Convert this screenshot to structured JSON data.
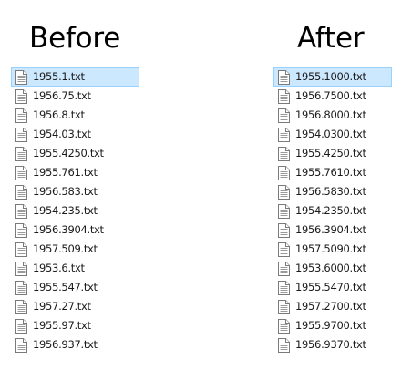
{
  "before": {
    "title": "Before",
    "selected_index": 0,
    "files": [
      "1955.1.txt",
      "1956.75.txt",
      "1956.8.txt",
      "1954.03.txt",
      "1955.4250.txt",
      "1955.761.txt",
      "1956.583.txt",
      "1954.235.txt",
      "1956.3904.txt",
      "1957.509.txt",
      "1953.6.txt",
      "1955.547.txt",
      "1957.27.txt",
      "1955.97.txt",
      "1956.937.txt"
    ]
  },
  "after": {
    "title": "After",
    "selected_index": 0,
    "files": [
      "1955.1000.txt",
      "1956.7500.txt",
      "1956.8000.txt",
      "1954.0300.txt",
      "1955.4250.txt",
      "1955.7610.txt",
      "1956.5830.txt",
      "1954.2350.txt",
      "1956.3904.txt",
      "1957.5090.txt",
      "1953.6000.txt",
      "1955.5470.txt",
      "1957.2700.txt",
      "1955.9700.txt",
      "1956.9370.txt"
    ]
  },
  "icon": "text-file-icon",
  "colors": {
    "selection_fill": "#cce8ff",
    "selection_border": "#99d1ff"
  }
}
